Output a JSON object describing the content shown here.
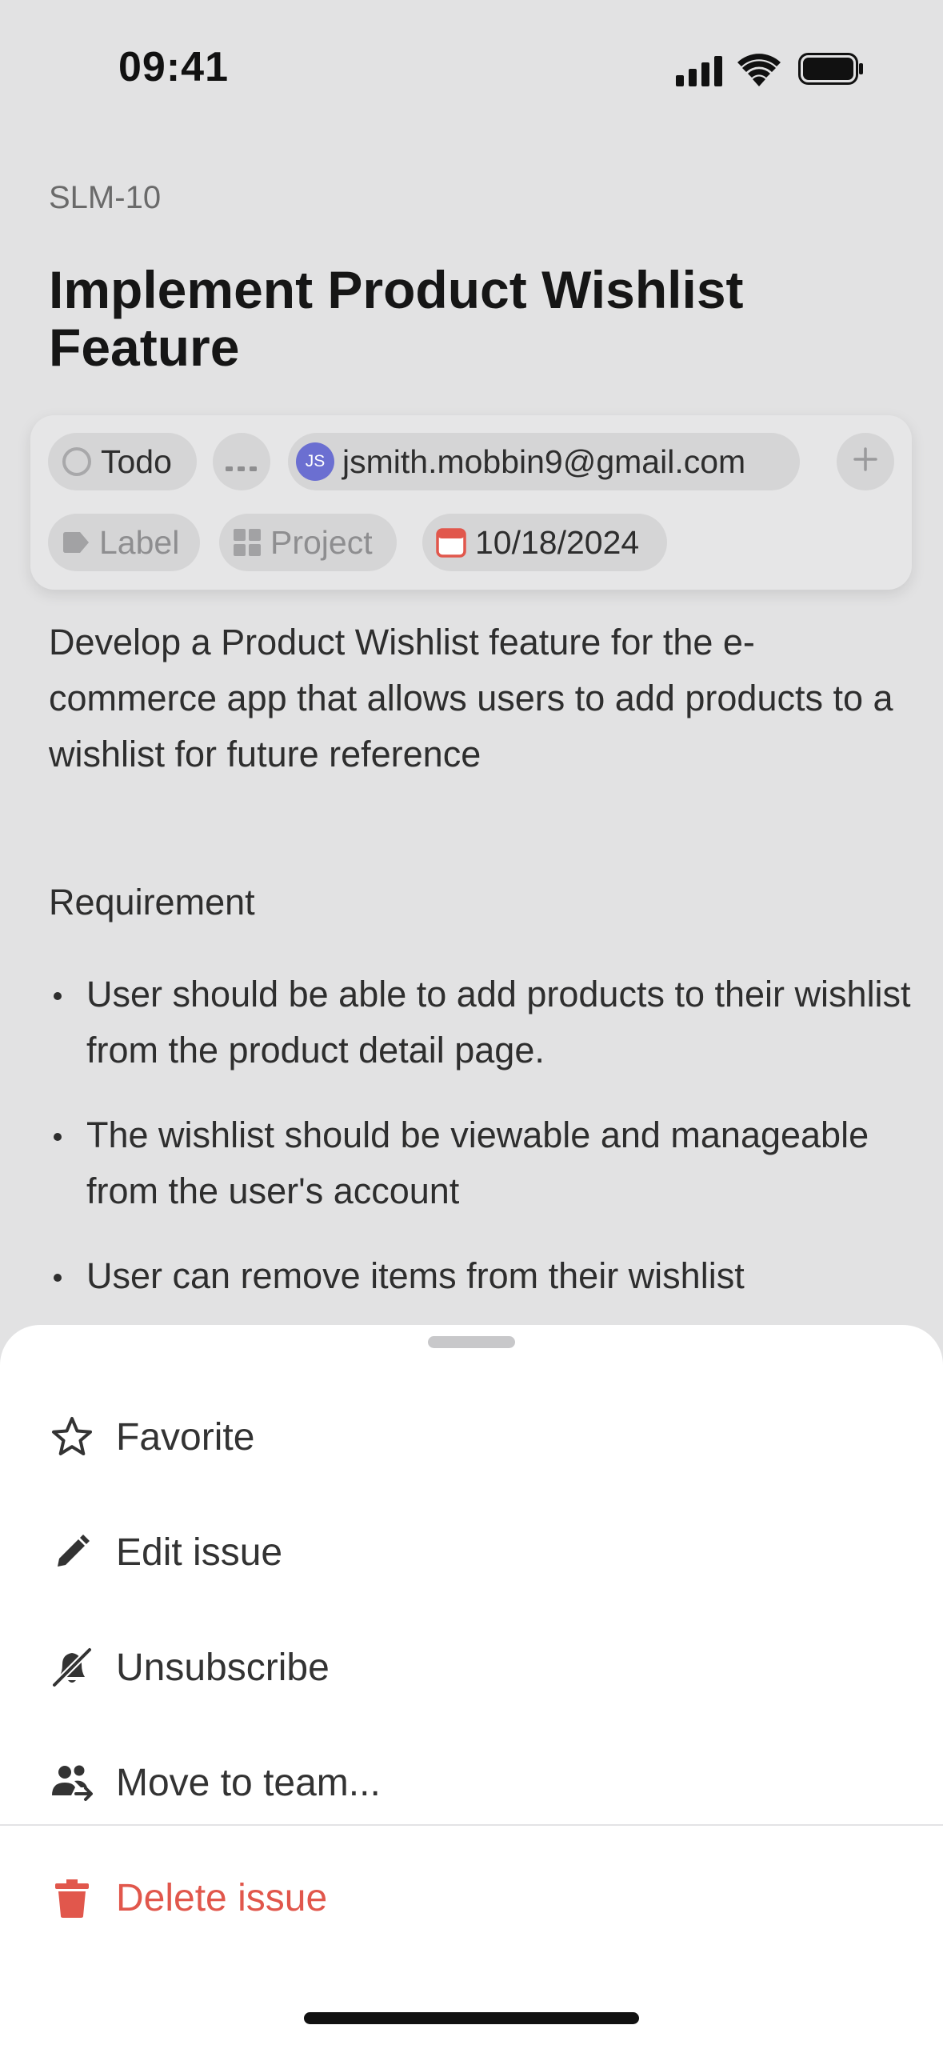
{
  "status_bar": {
    "time": "09:41"
  },
  "issue": {
    "id": "SLM-10",
    "title": "Implement Product Wishlist Feature",
    "properties": {
      "status": "Todo",
      "priority_icon": "more-dots-icon",
      "assignee_initials": "JS",
      "assignee_email": "jsmith.mobbin9@gmail.com",
      "label_placeholder": "Label",
      "project_placeholder": "Project",
      "due_date": "10/18/2024"
    },
    "description": "Develop a Product Wishlist feature for the e-commerce app that allows users to add products to a wishlist for future reference",
    "requirement_heading": "Requirement",
    "requirements": [
      "User should be able to add products to their wishlist from the product detail page.",
      "The wishlist should be viewable and manageable from the user's account",
      "User can remove items from their wishlist"
    ]
  },
  "action_sheet": {
    "items": [
      {
        "label": "Favorite",
        "icon": "star-icon"
      },
      {
        "label": "Edit issue",
        "icon": "pencil-icon"
      },
      {
        "label": "Unsubscribe",
        "icon": "bell-off-icon"
      },
      {
        "label": "Move to team...",
        "icon": "team-move-icon"
      },
      {
        "label": "Delete issue",
        "icon": "trash-icon"
      }
    ]
  },
  "colors": {
    "background_dim": "#e2e2e3",
    "danger": "#e1574c",
    "avatar": "#6b6fd1",
    "calendar": "#e1574c"
  }
}
